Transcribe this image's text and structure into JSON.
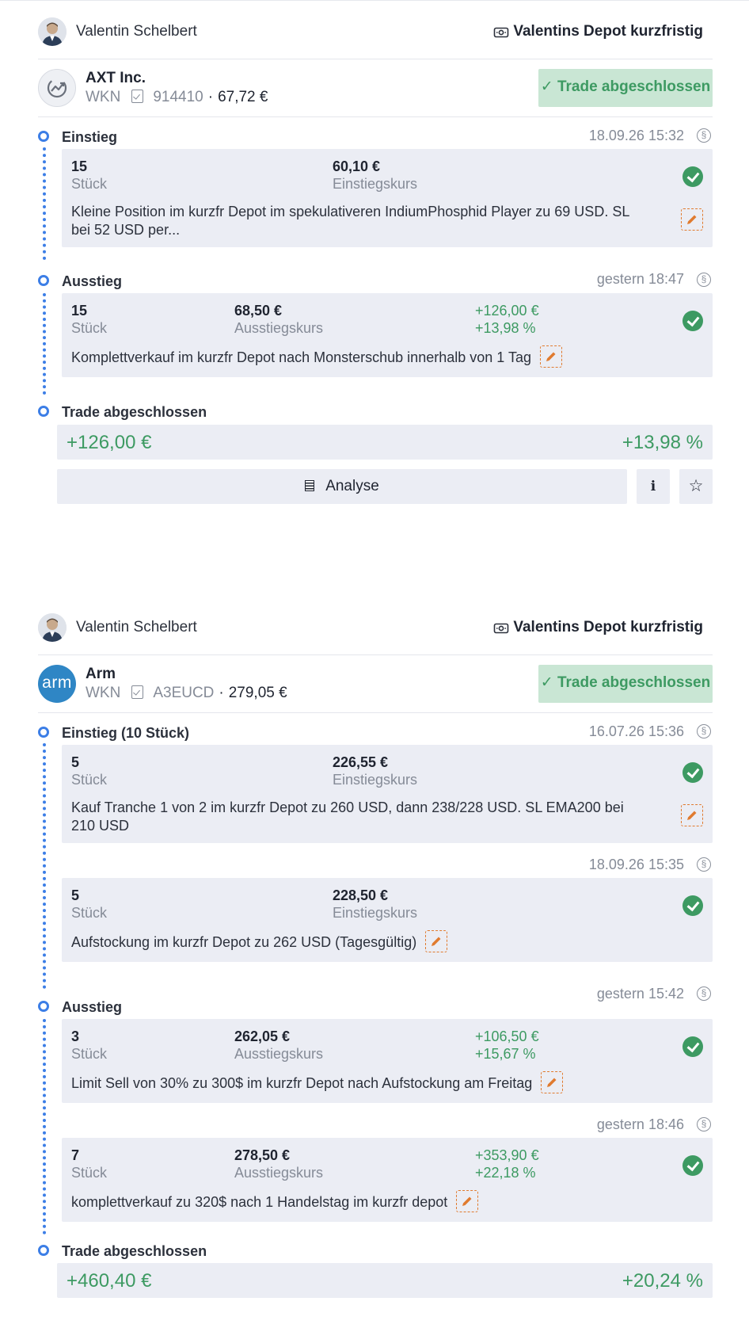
{
  "trades": [
    {
      "user": {
        "name": "Valentin Schelbert"
      },
      "depot": {
        "name": "Valentins Depot kurzfristig",
        "icon": "money-icon"
      },
      "asset": {
        "name": "AXT Inc.",
        "wkn_label": "WKN",
        "wkn": "914410",
        "price": "67,72 €",
        "logo": "trend-icon"
      },
      "status": "✓ Trade abgeschlossen",
      "entry": {
        "title": "Einstieg",
        "orders": [
          {
            "date": "18.09.26 15:32",
            "qty": "15",
            "qty_label": "Stück",
            "price": "60,10 €",
            "price_label": "Einstiegskurs",
            "note_line1": "Kleine Position im kurzfr Depot im spekulativeren IndiumPhosphid Player zu 69 USD. SL",
            "note_line2": "bei 52 USD per..."
          }
        ]
      },
      "exit": {
        "title": "Ausstieg",
        "orders": [
          {
            "date": "gestern 18:47",
            "qty": "15",
            "qty_label": "Stück",
            "price": "68,50 €",
            "price_label": "Ausstiegskurs",
            "pl_abs": "+126,00 €",
            "pl_pct": "+13,98 %",
            "note": "Komplettverkauf im kurzfr Depot nach Monsterschub innerhalb von 1 Tag"
          }
        ]
      },
      "closed": {
        "title": "Trade abgeschlossen",
        "total": "+126,00 €",
        "total_pct": "+13,98 %"
      },
      "actions": {
        "analyse": "Analyse",
        "info": "i",
        "star": "☆"
      }
    },
    {
      "user": {
        "name": "Valentin Schelbert"
      },
      "depot": {
        "name": "Valentins Depot kurzfristig",
        "icon": "money-icon"
      },
      "asset": {
        "name": "Arm",
        "wkn_label": "WKN",
        "wkn": "A3EUCD",
        "price": "279,05 €",
        "logo": "arm"
      },
      "status": "✓ Trade abgeschlossen",
      "entry": {
        "title": "Einstieg (10 Stück)",
        "orders": [
          {
            "date": "16.07.26 15:36",
            "qty": "5",
            "qty_label": "Stück",
            "price": "226,55 €",
            "price_label": "Einstiegskurs",
            "note_line1": "Kauf Tranche 1 von 2 im kurzfr Depot zu 260 USD, dann 238/228 USD. SL EMA200 bei",
            "note_line2": "210 USD"
          },
          {
            "date": "18.09.26 15:35",
            "qty": "5",
            "qty_label": "Stück",
            "price": "228,50 €",
            "price_label": "Einstiegskurs",
            "note": "Aufstockung im kurzfr Depot zu 262 USD (Tagesgültig)"
          }
        ]
      },
      "exit": {
        "title": "Ausstieg",
        "orders": [
          {
            "date": "gestern 15:42",
            "qty": "3",
            "qty_label": "Stück",
            "price": "262,05 €",
            "price_label": "Ausstiegskurs",
            "pl_abs": "+106,50 €",
            "pl_pct": "+15,67 %",
            "note": "Limit Sell von 30% zu 300$ im kurzfr Depot nach Aufstockung am Freitag"
          },
          {
            "date": "gestern 18:46",
            "qty": "7",
            "qty_label": "Stück",
            "price": "278,50 €",
            "price_label": "Ausstiegskurs",
            "pl_abs": "+353,90 €",
            "pl_pct": "+22,18 %",
            "note": "komplettverkauf zu 320$ nach 1 Handelstag im kurzfr depot"
          }
        ]
      },
      "closed": {
        "title": "Trade abgeschlossen",
        "total": "+460,40 €",
        "total_pct": "+20,24 %"
      }
    }
  ],
  "colors": {
    "accent": "#3c7ee6",
    "profit": "#3d9a62",
    "status_bg": "#c9e6d4",
    "card_bg": "#ebedf4",
    "edit": "#e07b2f"
  }
}
